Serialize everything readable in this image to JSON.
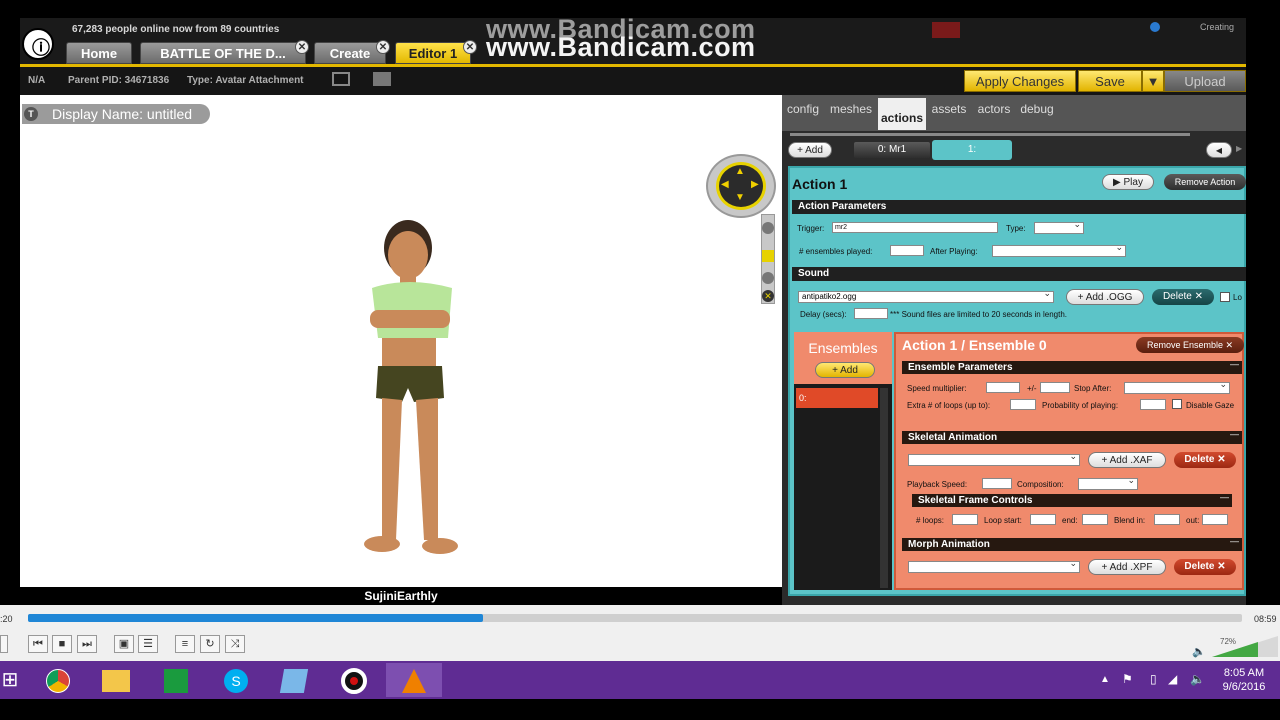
{
  "top": {
    "online_text": "67,283 people online now from 89 countries",
    "watermark": "www.Bandicam.com",
    "creating": "Creating",
    "tabs": [
      {
        "label": "Home"
      },
      {
        "label": "BATTLE OF THE D..."
      },
      {
        "label": "Create"
      },
      {
        "label": "Editor 1"
      }
    ],
    "close_glyph": "✕"
  },
  "subbar": {
    "pid": "N/A",
    "parent_pid": "Parent PID: 34671836",
    "type": "Type: Avatar Attachment",
    "apply": "Apply Changes",
    "save": "Save",
    "upload": "Upload"
  },
  "viewport": {
    "display_name": "Display Name: untitled",
    "t_glyph": "T",
    "username": "SujiniEarthly"
  },
  "panel": {
    "tabs": [
      "config",
      "meshes",
      "actions",
      "assets",
      "actors",
      "debug"
    ],
    "add": "Add",
    "action_tabs": [
      "0: Mr1",
      "1:"
    ],
    "action_title": "Action 1",
    "play": "Play",
    "remove_action": "Remove Action",
    "action_params": "Action Parameters",
    "trigger_label": "Trigger:",
    "trigger_value": "mr2",
    "type_label": "Type:",
    "ensembles_played": "# ensembles played:",
    "after_playing": "After Playing:",
    "sound": "Sound",
    "sound_file": "antipatiko2.ogg",
    "add_ogg": "Add .OGG",
    "delete": "Delete",
    "lo": "Lo",
    "delay_label": "Delay (secs):",
    "sound_note": "*** Sound files are limited to 20 seconds in length.",
    "ensembles": "Ensembles",
    "ens_add": "Add",
    "ens_item": "0:",
    "ensemble_title": "Action 1 / Ensemble 0",
    "remove_ensemble": "Remove Ensemble",
    "ens_params": "Ensemble Parameters",
    "speed_mult": "Speed multiplier:",
    "plusminus": "+/-",
    "stop_after": "Stop After:",
    "extra_loops": "Extra # of loops (up to):",
    "prob_playing": "Probability of playing:",
    "disable_gaze": "Disable Gaze",
    "skeletal_anim": "Skeletal Animation",
    "add_xaf": "Add .XAF",
    "playback_speed": "Playback Speed:",
    "composition": "Composition:",
    "skel_frame": "Skeletal Frame Controls",
    "loops": "# loops:",
    "loop_start": "Loop start:",
    "end": "end:",
    "blend_in": "Blend in:",
    "out": "out:",
    "morph_anim": "Morph Animation",
    "add_xpf": "Add .XPF",
    "collapse": "—"
  },
  "player": {
    "time_left": ":20",
    "time_right": "08:59",
    "progress": 0.375,
    "volume": "72%"
  },
  "taskbar": {
    "time": "8:05 AM",
    "date": "9/6/2016"
  }
}
